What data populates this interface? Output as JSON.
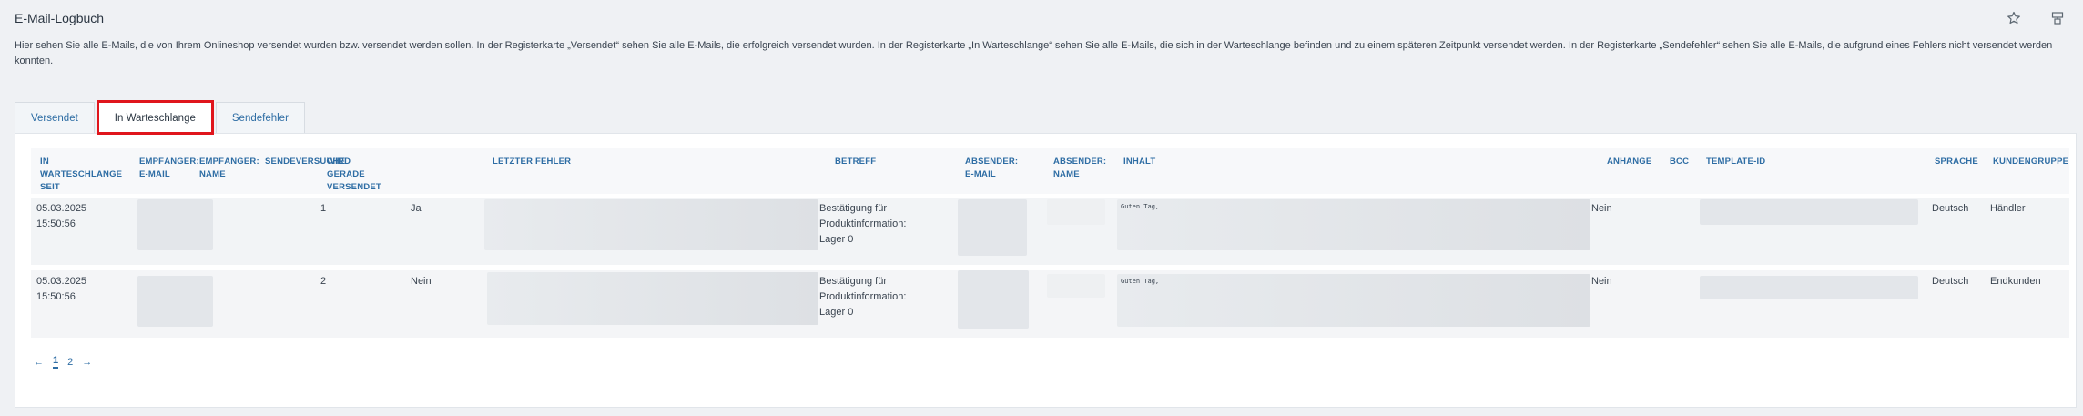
{
  "page": {
    "title": "E-Mail-Logbuch",
    "description": "Hier sehen Sie alle E-Mails, die von Ihrem Onlineshop versendet wurden bzw. versendet werden sollen. In der Registerkarte „Versendet“ sehen Sie alle E-Mails, die erfolgreich versendet wurden. In der Registerkarte „In Warteschlange“ sehen Sie alle E-Mails, die sich in der Warteschlange befinden und zu einem späteren Zeitpunkt versendet werden. In der Registerkarte „Sendefehler“ sehen Sie alle E-Mails, die aufgrund eines Fehlers nicht versendet werden konnten."
  },
  "top_icons": [
    "star-icon",
    "save-layout-icon"
  ],
  "tabs": [
    {
      "label": "Versendet"
    },
    {
      "label": "In Warteschlange",
      "active": true
    },
    {
      "label": "Sendefehler"
    }
  ],
  "columns": {
    "queued_since": "In Warteschlange seit",
    "recipient_email": "Empfänger: E-Mail",
    "recipient_name": "Empfänger: Name",
    "attempts": "Sendeversuche",
    "sending_now": "Wird gerade versendet",
    "last_error": "Letzter Fehler",
    "subject": "Betreff",
    "sender_email": "Absender: E-Mail",
    "sender_name": "Absender: Name",
    "content": "Inhalt",
    "attachments": "Anhänge",
    "bcc": "BCC",
    "template_id": "Template-ID",
    "language": "Sprache",
    "customer_group": "Kundengruppe"
  },
  "rows": [
    {
      "date": "05.03.2025",
      "time": "15:50:56",
      "attempts": "1",
      "sending_now": "Ja",
      "subject": "Bestätigung für Produktinformation: Lager 0",
      "content_snippet": "Guten Tag,",
      "attachments": "Nein",
      "language": "Deutsch",
      "customer_group": "Händler"
    },
    {
      "date": "05.03.2025",
      "time": "15:50:56",
      "attempts": "2",
      "sending_now": "Nein",
      "subject": "Bestätigung für Produktinformation: Lager 0",
      "content_snippet": "Guten Tag,",
      "attachments": "Nein",
      "language": "Deutsch",
      "customer_group": "Endkunden"
    }
  ],
  "pagination": {
    "prev": "←",
    "pages": [
      "1",
      "2"
    ],
    "current": "1",
    "next": "→"
  }
}
